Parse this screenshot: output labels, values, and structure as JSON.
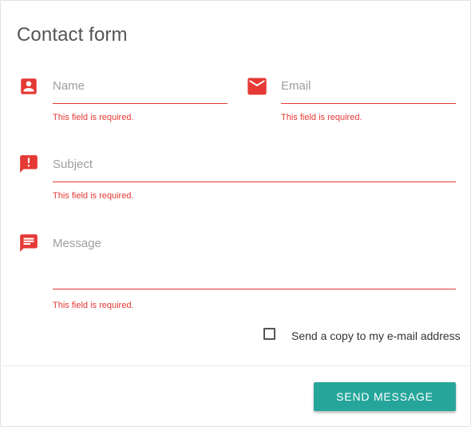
{
  "form": {
    "title": "Contact form",
    "accent_color": "#e53935",
    "fields": {
      "name": {
        "placeholder": "Name",
        "error": "This field is required.",
        "icon": "account-box-icon"
      },
      "email": {
        "placeholder": "Email",
        "error": "This field is required.",
        "icon": "email-icon"
      },
      "subject": {
        "placeholder": "Subject",
        "error": "This field is required.",
        "icon": "announcement-icon"
      },
      "message": {
        "placeholder": "Message",
        "error": "This field is required.",
        "icon": "chat-icon"
      }
    },
    "copy_checkbox": {
      "label": "Send a copy to my e-mail address",
      "checked": false
    },
    "submit": {
      "label": "SEND MESSAGE",
      "color": "#26a69a"
    }
  }
}
